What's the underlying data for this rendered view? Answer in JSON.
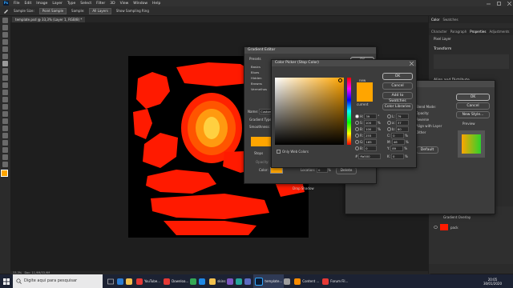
{
  "menubar": {
    "items": [
      "File",
      "Edit",
      "Image",
      "Layer",
      "Type",
      "Select",
      "Filter",
      "3D",
      "View",
      "Window",
      "Help"
    ]
  },
  "options": {
    "sample_size_label": "Sample Size:",
    "sample_size": "Point Sample",
    "sample_label": "Sample:",
    "sample": "All Layers",
    "show_ring": "Show Sampling Ring"
  },
  "document": {
    "tab_title": "template.psd @ 33,3% (Layer 1, RGB/8) *",
    "zoom": "33,3%",
    "doc_info": "Doc: 11,9M/33,9M"
  },
  "gradient_editor": {
    "title": "Gradient Editor",
    "presets_label": "Presets",
    "folders": [
      "Basics",
      "Blues",
      "Hidden",
      "Browns",
      "Vermelhos"
    ],
    "name_label": "Name:",
    "name_value": "Custom",
    "gradient_type_label": "Gradient Type:",
    "smoothness_label": "Smoothness:",
    "stops_label": "Stops",
    "opacity_label": "Opacity:",
    "color_label": "Color:",
    "location_label": "Location:",
    "location_value": "0",
    "pct": "%",
    "delete_label": "Delete",
    "ok": "OK",
    "cancel": "Cancel"
  },
  "color_picker": {
    "title": "Color Picker (Stop Color)",
    "new_label": "new",
    "current_label": "current",
    "ok": "OK",
    "cancel": "Cancel",
    "add_swatches": "Add to Swatches",
    "color_libraries": "Color Libraries",
    "only_web": "Only Web Colors",
    "h_label": "H:",
    "h_val": "39",
    "h_unit": "°",
    "s_label": "S:",
    "s_val": "100",
    "s_unit": "%",
    "b_label": "B:",
    "b_val": "100",
    "b_unit": "%",
    "r_label": "R:",
    "r_val": "255",
    "g_label": "G:",
    "g_val": "165",
    "b2_label": "B:",
    "b2_val": "0",
    "l_label": "L:",
    "l_val": "79",
    "a_label": "a:",
    "a_val": "37",
    "bb_label": "b:",
    "bb_val": "80",
    "c_label": "C:",
    "c_val": "0",
    "c_unit": "%",
    "m_label": "M:",
    "m_val": "46",
    "m_unit": "%",
    "y_label": "Y:",
    "y_val": "89",
    "y_unit": "%",
    "k_label": "K:",
    "k_val": "0",
    "k_unit": "%",
    "hex_label": "#",
    "hex_val": "ffa500"
  },
  "layer_style": {
    "ok": "OK",
    "cancel": "Cancel",
    "new_style": "New Style...",
    "preview": "Preview",
    "items": [
      "Blend Mode:",
      "Opacity:",
      "Reverse",
      "Align with Layer",
      "Dither",
      "Default"
    ],
    "drop_shadow": "Drop Shadow"
  },
  "right_panel": {
    "tabs_top": [
      "Color",
      "Swatches"
    ],
    "tabs": [
      "Character",
      "Paragraph",
      "Properties",
      "Adjustments"
    ],
    "pixel_layer": "Pixel Layer",
    "transform": "Transform",
    "align": "Align and Distribute",
    "layer_effects": "Effects",
    "gradient_overlay": "Gradient Overlay",
    "layer_name": "pack"
  },
  "taskbar": {
    "search": "Digite aqui para pesquisar",
    "apps": [
      "YouTube...",
      "Downloa...",
      "skins",
      "template...",
      "Content ...",
      "Forum Fil..."
    ],
    "time": "20:05",
    "date": "30/01/2020"
  },
  "colors": {
    "accent": "#31a8ff",
    "orange": "#ffa500",
    "red": "#ff1a00",
    "panel": "#3c3c3c"
  }
}
